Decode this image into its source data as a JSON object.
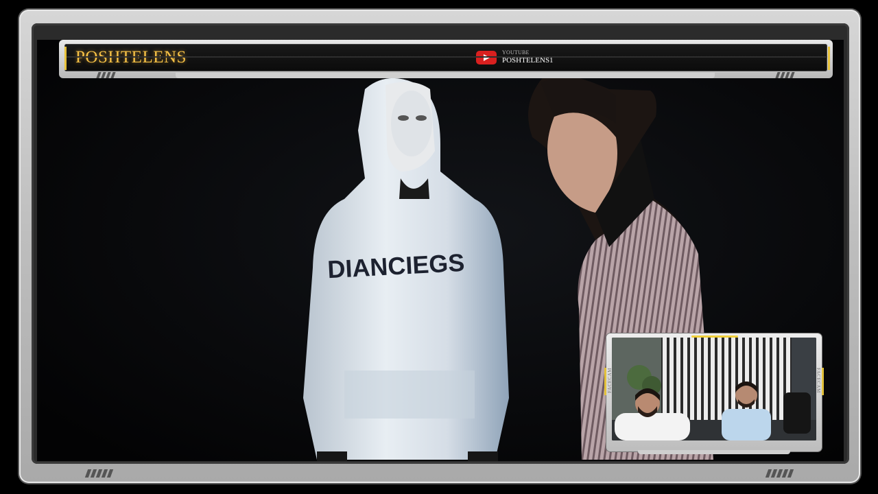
{
  "overlay": {
    "brand_title": "POSHTELENS",
    "youtube_label": "YOUTUBE",
    "youtube_channel": "POSHTELENS1",
    "facecam_label_left": "FACECAM",
    "facecam_label_right": "FACECAM"
  },
  "scene": {
    "hoodie_text": "DIANCIEGS"
  },
  "colors": {
    "brand_gold": "#f6c146",
    "youtube_red": "#d9201f",
    "accent_yellow": "#e8c23a"
  }
}
